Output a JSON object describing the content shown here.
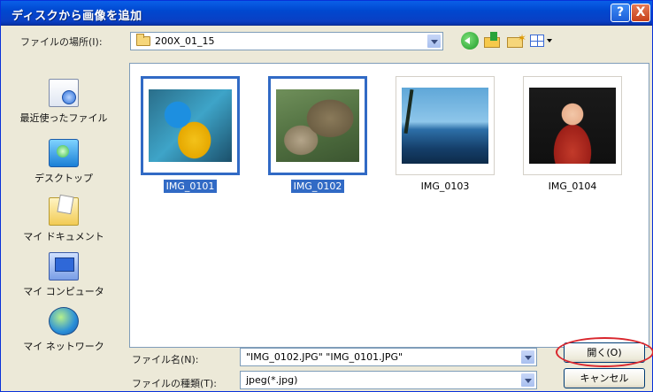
{
  "window": {
    "title": "ディスクから画像を追加",
    "help_icon": "?",
    "close_icon": "X"
  },
  "look_in": {
    "label": "ファイルの場所(I):",
    "value": "200X_01_15"
  },
  "toolbar": {
    "icons": [
      "back-icon",
      "up-folder-icon",
      "new-folder-icon",
      "view-menu-icon"
    ]
  },
  "places": [
    {
      "label": "最近使ったファイル",
      "icon": "recent-files-icon"
    },
    {
      "label": "デスクトップ",
      "icon": "desktop-icon"
    },
    {
      "label": "マイ ドキュメント",
      "icon": "my-documents-icon"
    },
    {
      "label": "マイ コンピュータ",
      "icon": "my-computer-icon"
    },
    {
      "label": "マイ ネットワーク",
      "icon": "my-network-icon"
    }
  ],
  "files": [
    {
      "name": "IMG_0101",
      "selected": true
    },
    {
      "name": "IMG_0102",
      "selected": true
    },
    {
      "name": "IMG_0103",
      "selected": false
    },
    {
      "name": "IMG_0104",
      "selected": false
    }
  ],
  "file_name": {
    "label": "ファイル名(N):",
    "value": "\"IMG_0102.JPG\" \"IMG_0101.JPG\""
  },
  "file_type": {
    "label": "ファイルの種類(T):",
    "value": "jpeg(*.jpg)"
  },
  "buttons": {
    "open": "開く(O)",
    "cancel": "キャンセル"
  },
  "colors": {
    "titlebar": "#0a4fd8",
    "selection": "#316ac5",
    "highlight_ring": "#d9272e"
  }
}
